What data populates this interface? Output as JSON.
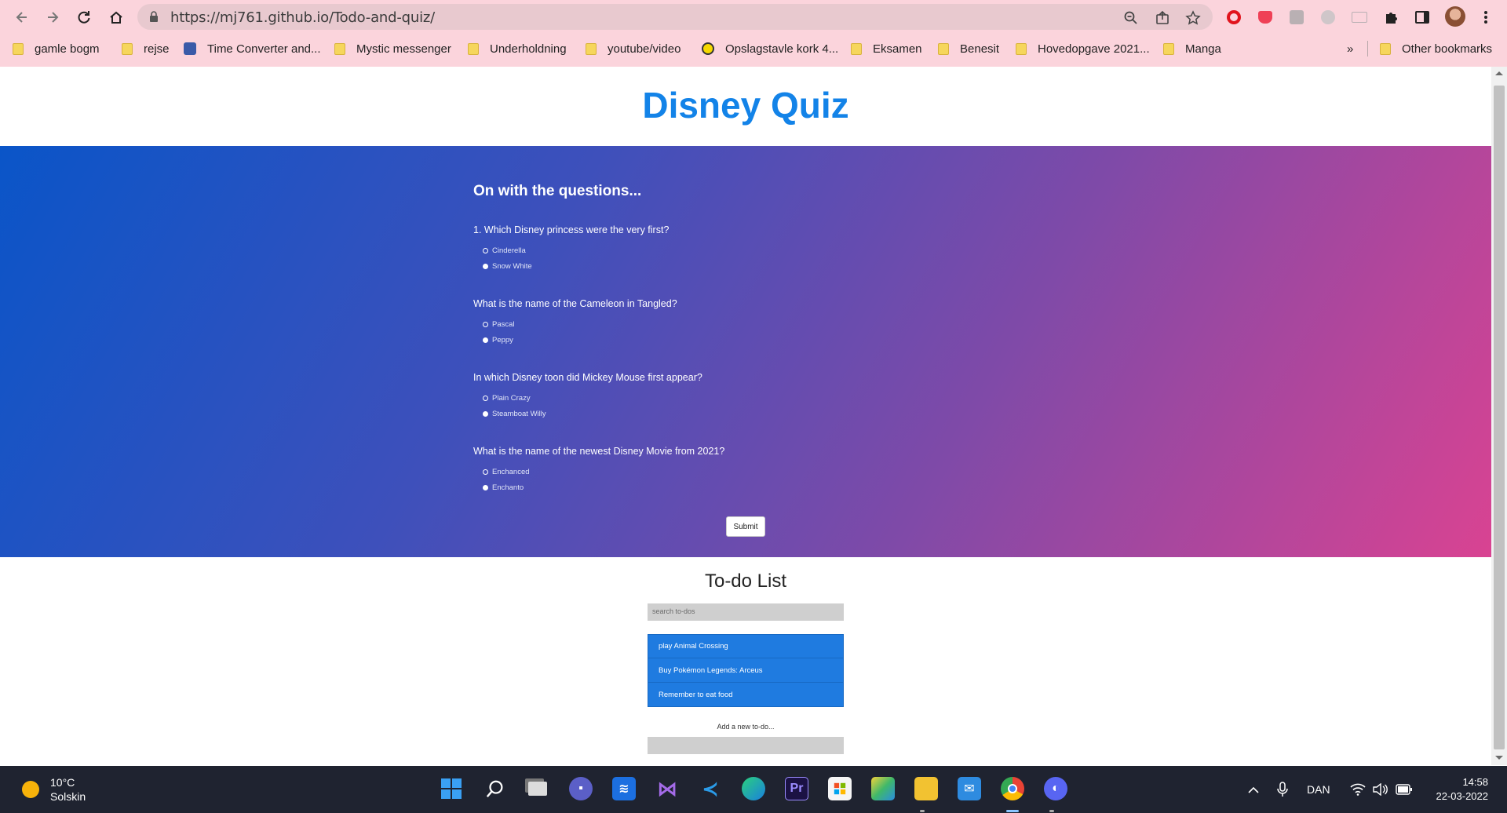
{
  "browser": {
    "url": "https://mj761.github.io/Todo-and-quiz/",
    "bookmarks": [
      {
        "label": "gamle bogm",
        "icon": "folder-icon"
      },
      {
        "label": "rejse",
        "icon": "folder-icon"
      },
      {
        "label": "Time Converter and...",
        "icon": "clock-site-icon"
      },
      {
        "label": "Mystic messenger",
        "icon": "folder-icon"
      },
      {
        "label": "Underholdning",
        "icon": "folder-icon"
      },
      {
        "label": "youtube/video",
        "icon": "folder-icon"
      },
      {
        "label": "Opslagstavle kork 4...",
        "icon": "site-icon"
      },
      {
        "label": "Eksamen",
        "icon": "folder-icon"
      },
      {
        "label": "Benesit",
        "icon": "folder-icon"
      },
      {
        "label": "Hovedopgave 2021...",
        "icon": "folder-icon"
      },
      {
        "label": "Manga",
        "icon": "folder-icon"
      }
    ],
    "more_bookmarks": "»",
    "other_bookmarks": "Other bookmarks"
  },
  "quiz": {
    "title": "Disney Quiz",
    "heading": "On with the questions...",
    "questions": [
      {
        "text": "1. Which Disney princess were the very first?",
        "options": [
          "Cinderella",
          "Snow White"
        ]
      },
      {
        "text": "What is the name of the Cameleon in Tangled?",
        "options": [
          "Pascal",
          "Peppy"
        ]
      },
      {
        "text": "In which Disney toon did Mickey Mouse first appear?",
        "options": [
          "Plain Crazy",
          "Steamboat Willy"
        ]
      },
      {
        "text": "What is the name of the newest Disney Movie from 2021?",
        "options": [
          "Enchanced",
          "Enchanto"
        ]
      }
    ],
    "submit_label": "Submit"
  },
  "todo": {
    "title": "To-do List",
    "search_placeholder": "search to-dos",
    "items": [
      "play Animal Crossing",
      "Buy Pokémon Legends: Arceus",
      "Remember to eat food"
    ],
    "add_label": "Add a new to-do..."
  },
  "taskbar": {
    "weather_temp": "10°C",
    "weather_desc": "Solskin",
    "language": "DAN",
    "time": "14:58",
    "date": "22-03-2022"
  },
  "colors": {
    "chrome_bg": "#fbd4dc",
    "title_blue": "#1383e8",
    "todo_item_blue": "#1f7be0",
    "gradient_start": "#0a55c8",
    "gradient_end": "#d94392",
    "taskbar_bg": "#1f2330"
  }
}
